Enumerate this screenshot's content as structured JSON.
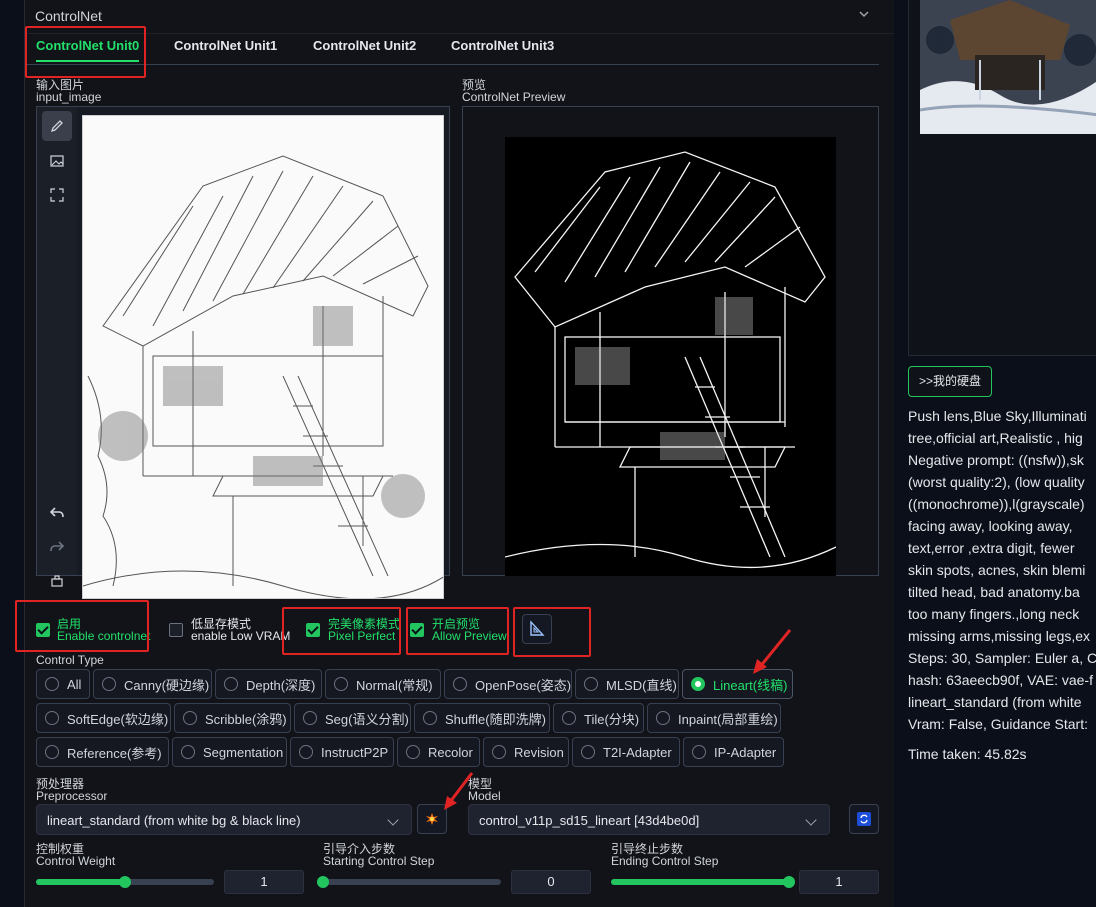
{
  "accordion": {
    "title": "ControlNet"
  },
  "tabs": [
    "ControlNet Unit0",
    "ControlNet Unit1",
    "ControlNet Unit2",
    "ControlNet Unit3"
  ],
  "input_image": {
    "label_cn": "输入图片",
    "label_en": "input_image"
  },
  "preview": {
    "label_cn": "预览",
    "label_en": "ControlNet Preview"
  },
  "options": {
    "enable": {
      "cn": "启用",
      "en": "Enable controlnet",
      "checked": true
    },
    "low_vram": {
      "cn": "低显存模式",
      "en": "enable Low VRAM",
      "checked": false
    },
    "pixel_perfect": {
      "cn": "完美像素模式",
      "en": "Pixel Perfect",
      "checked": true
    },
    "allow_preview": {
      "cn": "开启预览",
      "en": "Allow Preview",
      "checked": true
    }
  },
  "control_type": {
    "label": "Control Type",
    "options": [
      "All",
      "Canny(硬边缘)",
      "Depth(深度)",
      "Normal(常规)",
      "OpenPose(姿态)",
      "MLSD(直线)",
      "Lineart(线稿)",
      "SoftEdge(软边缘)",
      "Scribble(涂鸦)",
      "Seg(语义分割)",
      "Shuffle(随即洗牌)",
      "Tile(分块)",
      "Inpaint(局部重绘)",
      "Reference(参考)",
      "Segmentation",
      "InstructP2P",
      "Recolor",
      "Revision",
      "T2I-Adapter",
      "IP-Adapter"
    ],
    "selected": "Lineart(线稿)"
  },
  "preprocessor": {
    "label_cn": "预处理器",
    "label_en": "Preprocessor",
    "value": "lineart_standard (from white bg & black line)"
  },
  "model": {
    "label_cn": "模型",
    "label_en": "Model",
    "value": "control_v11p_sd15_lineart [43d4be0d]"
  },
  "sliders": {
    "weight": {
      "label_cn": "控制权重",
      "label_en": "Control Weight",
      "value": "1",
      "fraction": 0.5
    },
    "start": {
      "label_cn": "引导介入步数",
      "label_en": "Starting Control Step",
      "value": "0",
      "fraction": 0.0
    },
    "end": {
      "label_cn": "引导终止步数",
      "label_en": "Ending Control Step",
      "value": "1",
      "fraction": 1.0
    }
  },
  "output": {
    "folder_button": ">>我的硬盘",
    "info_lines": [
      "Push lens,Blue Sky,Illuminati",
      "tree,official art,Realistic , hig",
      "Negative prompt: ((nsfw)),sk",
      "(worst quality:2), (low quality",
      "((monochrome)),l(grayscale)",
      "facing away, looking away,",
      "text,error ,extra digit, fewer",
      "skin spots, acnes, skin blemi",
      "tilted head, bad anatomy.ba",
      "too many fingers.,long neck",
      "missing arms,missing legs,ex",
      "Steps: 30, Sampler: Euler a, C",
      "hash: 63aeecb90f, VAE: vae-f",
      "lineart_standard (from white",
      "Vram: False, Guidance Start:"
    ],
    "time_taken": "Time taken: 45.82s"
  },
  "colors": {
    "accent": "#22c55e",
    "highlight_box": "#e02424",
    "background": "#0b0f19"
  }
}
